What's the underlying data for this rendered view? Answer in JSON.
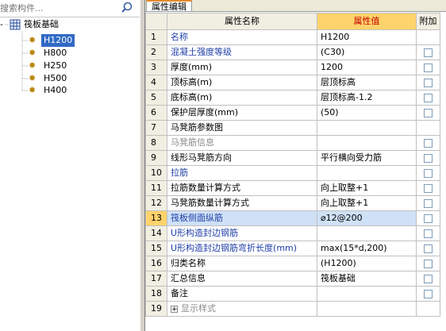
{
  "search": {
    "placeholder": "搜索构件..."
  },
  "tree": {
    "root": {
      "label": "筏板基础",
      "expander": "-"
    },
    "items": [
      {
        "label": "H1200",
        "selected": true
      },
      {
        "label": "H800"
      },
      {
        "label": "H250"
      },
      {
        "label": "H500"
      },
      {
        "label": "H400"
      }
    ]
  },
  "panel": {
    "tab": "属性编辑"
  },
  "grid": {
    "headers": {
      "name": "属性名称",
      "value": "属性值",
      "extra": "附加"
    },
    "rows": [
      {
        "num": "1",
        "name": "名称",
        "value": "H1200",
        "style": "blue",
        "check": false
      },
      {
        "num": "2",
        "name": "混凝土强度等级",
        "value": "(C30)",
        "style": "blue",
        "check": true
      },
      {
        "num": "3",
        "name": "厚度(mm)",
        "value": "1200",
        "style": "dark",
        "check": true
      },
      {
        "num": "4",
        "name": "顶标高(m)",
        "value": "层顶标高",
        "style": "dark",
        "check": true
      },
      {
        "num": "5",
        "name": "底标高(m)",
        "value": "层顶标高-1.2",
        "style": "dark",
        "check": true
      },
      {
        "num": "6",
        "name": "保护层厚度(mm)",
        "value": "(50)",
        "style": "dark",
        "check": true
      },
      {
        "num": "7",
        "name": "马凳筋参数图",
        "value": "",
        "style": "dark",
        "check": false
      },
      {
        "num": "8",
        "name": "马凳筋信息",
        "value": "",
        "style": "gray",
        "check": true
      },
      {
        "num": "9",
        "name": "线形马凳筋方向",
        "value": "平行横向受力筋",
        "style": "dark",
        "check": true
      },
      {
        "num": "10",
        "name": "拉筋",
        "value": "",
        "style": "blue",
        "check": true
      },
      {
        "num": "11",
        "name": "拉筋数量计算方式",
        "value": "向上取整+1",
        "style": "dark",
        "check": true
      },
      {
        "num": "12",
        "name": "马凳筋数量计算方式",
        "value": "向上取整+1",
        "style": "dark",
        "check": true
      },
      {
        "num": "13",
        "name": "筏板侧面纵筋",
        "value": "⌀12@200",
        "style": "blue",
        "check": true,
        "selected": true
      },
      {
        "num": "14",
        "name": "U形构造封边钢筋",
        "value": "",
        "style": "blue",
        "check": true
      },
      {
        "num": "15",
        "name": "U形构造封边钢筋弯折长度(mm)",
        "value": "max(15*d,200)",
        "style": "blue",
        "check": true
      },
      {
        "num": "16",
        "name": "归类名称",
        "value": "(H1200)",
        "style": "dark",
        "check": true
      },
      {
        "num": "17",
        "name": "汇总信息",
        "value": "筏板基础",
        "style": "dark",
        "check": true
      },
      {
        "num": "18",
        "name": "备注",
        "value": "",
        "style": "dark",
        "check": true
      },
      {
        "num": "19",
        "name": "显示样式",
        "value": "",
        "style": "gray",
        "check": false,
        "expander": "+"
      }
    ]
  },
  "colors": {
    "highlight": "#ffd36b",
    "selection": "#cfe1f6",
    "link_blue": "#1f3fa8"
  },
  "icons": {
    "search": "search-icon",
    "root": "grid-component-icon",
    "child": "gear-icon"
  }
}
